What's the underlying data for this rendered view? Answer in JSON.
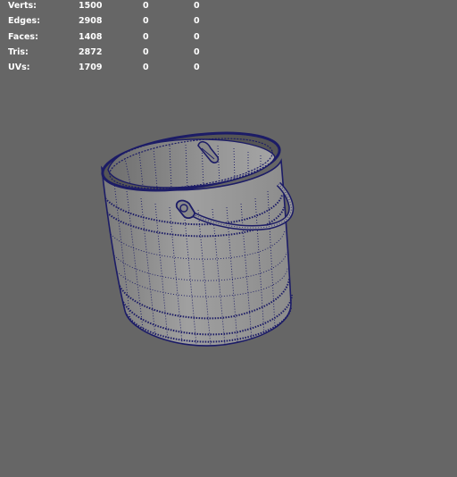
{
  "hud": {
    "rows": [
      {
        "label": "Verts:",
        "total": "1500",
        "selected": "0",
        "selected_alt": "0"
      },
      {
        "label": "Edges:",
        "total": "2908",
        "selected": "0",
        "selected_alt": "0"
      },
      {
        "label": "Faces:",
        "total": "1408",
        "selected": "0",
        "selected_alt": "0"
      },
      {
        "label": "Tris:",
        "total": "2872",
        "selected": "0",
        "selected_alt": "0"
      },
      {
        "label": "UVs:",
        "total": "1709",
        "selected": "0",
        "selected_alt": "0"
      }
    ]
  },
  "colors": {
    "background": "#666666",
    "mesh_fill": "#8a8a8a",
    "wireframe": "#1c1c66",
    "hud_text": "#ffffff"
  }
}
